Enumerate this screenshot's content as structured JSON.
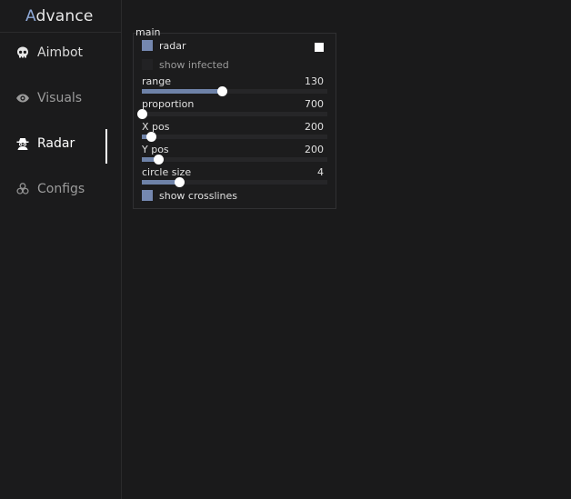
{
  "brand": {
    "first_letter": "A",
    "rest": "dvance"
  },
  "nav": [
    {
      "label": "Aimbot",
      "icon": "skull-icon"
    },
    {
      "label": "Visuals",
      "icon": "eye-icon"
    },
    {
      "label": "Radar",
      "icon": "spy-icon"
    },
    {
      "label": "Configs",
      "icon": "biohazard-icon"
    }
  ],
  "active_nav": "Radar",
  "panel": {
    "title": "main",
    "radar": {
      "label": "radar",
      "checked": true,
      "swatch_color": "#ffffff"
    },
    "show_infected": {
      "label": "show infected",
      "checked": false
    },
    "sliders": [
      {
        "label": "range",
        "value": "130",
        "fill": 0.43
      },
      {
        "label": "proportion",
        "value": "700",
        "fill": 0.0
      },
      {
        "label": "X pos",
        "value": "200",
        "fill": 0.05
      },
      {
        "label": "Y pos",
        "value": "200",
        "fill": 0.09
      },
      {
        "label": "circle size",
        "value": "4",
        "fill": 0.2
      }
    ],
    "show_crosslines": {
      "label": "show crosslines",
      "checked": true
    }
  },
  "colors": {
    "accent": "#7588b0",
    "slider_fill": "#6e82a8",
    "background": "#1a1a1b"
  }
}
